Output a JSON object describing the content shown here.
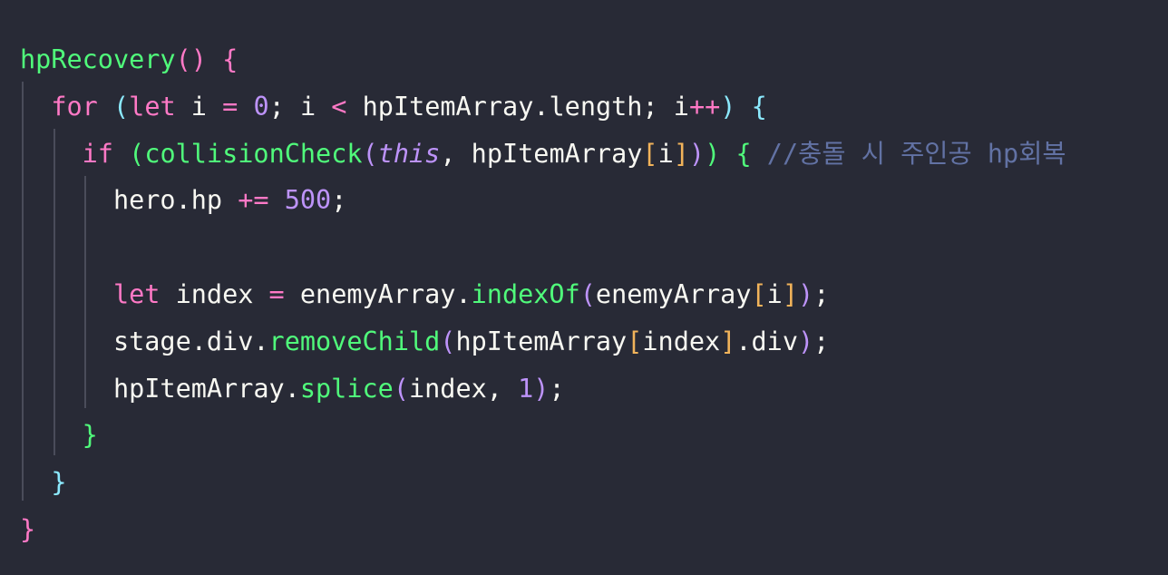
{
  "editor": {
    "theme_colors": {
      "background": "#282a36",
      "text": "#f8f8f2",
      "function": "#50fa7b",
      "keyword": "#ff79c6",
      "number": "#bd93f9",
      "comment": "#6272a4",
      "bracket_orange": "#f1b35a",
      "bracket_cyan": "#8be9fd"
    },
    "lines": [
      [
        {
          "t": "hpRecovery",
          "c": "fn"
        },
        {
          "t": "()",
          "c": "p1"
        },
        {
          "t": " ",
          "c": "txt"
        },
        {
          "t": "{",
          "c": "p1"
        }
      ],
      [
        {
          "t": "  ",
          "c": "txt"
        },
        {
          "t": "for",
          "c": "kw"
        },
        {
          "t": " ",
          "c": "txt"
        },
        {
          "t": "(",
          "c": "p2"
        },
        {
          "t": "let",
          "c": "kw"
        },
        {
          "t": " i ",
          "c": "txt"
        },
        {
          "t": "=",
          "c": "op"
        },
        {
          "t": " ",
          "c": "txt"
        },
        {
          "t": "0",
          "c": "num"
        },
        {
          "t": "; i ",
          "c": "txt"
        },
        {
          "t": "<",
          "c": "op"
        },
        {
          "t": " hpItemArray.length; i",
          "c": "txt"
        },
        {
          "t": "++",
          "c": "op"
        },
        {
          "t": ")",
          "c": "p2"
        },
        {
          "t": " ",
          "c": "txt"
        },
        {
          "t": "{",
          "c": "p2"
        }
      ],
      [
        {
          "t": "    ",
          "c": "txt"
        },
        {
          "t": "if",
          "c": "kw"
        },
        {
          "t": " ",
          "c": "txt"
        },
        {
          "t": "(",
          "c": "p3"
        },
        {
          "t": "collisionCheck",
          "c": "fn"
        },
        {
          "t": "(",
          "c": "p4"
        },
        {
          "t": "this",
          "c": "this"
        },
        {
          "t": ", hpItemArray",
          "c": "txt"
        },
        {
          "t": "[",
          "c": "br"
        },
        {
          "t": "i",
          "c": "txt"
        },
        {
          "t": "]",
          "c": "br"
        },
        {
          "t": ")",
          "c": "p4"
        },
        {
          "t": ")",
          "c": "p3"
        },
        {
          "t": " ",
          "c": "txt"
        },
        {
          "t": "{",
          "c": "p3"
        },
        {
          "t": " ",
          "c": "txt"
        },
        {
          "t": "//충돌 시 주인공 hp회복",
          "c": "cmt"
        }
      ],
      [
        {
          "t": "      hero.hp ",
          "c": "txt"
        },
        {
          "t": "+=",
          "c": "op"
        },
        {
          "t": " ",
          "c": "txt"
        },
        {
          "t": "500",
          "c": "num"
        },
        {
          "t": ";",
          "c": "txt"
        }
      ],
      [],
      [
        {
          "t": "      ",
          "c": "txt"
        },
        {
          "t": "let",
          "c": "kw"
        },
        {
          "t": " index ",
          "c": "txt"
        },
        {
          "t": "=",
          "c": "op"
        },
        {
          "t": " enemyArray.",
          "c": "txt"
        },
        {
          "t": "indexOf",
          "c": "fn"
        },
        {
          "t": "(",
          "c": "p4"
        },
        {
          "t": "enemyArray",
          "c": "txt"
        },
        {
          "t": "[",
          "c": "br"
        },
        {
          "t": "i",
          "c": "txt"
        },
        {
          "t": "]",
          "c": "br"
        },
        {
          "t": ")",
          "c": "p4"
        },
        {
          "t": ";",
          "c": "txt"
        }
      ],
      [
        {
          "t": "      stage.div.",
          "c": "txt"
        },
        {
          "t": "removeChild",
          "c": "fn"
        },
        {
          "t": "(",
          "c": "p4"
        },
        {
          "t": "hpItemArray",
          "c": "txt"
        },
        {
          "t": "[",
          "c": "br"
        },
        {
          "t": "index",
          "c": "txt"
        },
        {
          "t": "]",
          "c": "br"
        },
        {
          "t": ".div",
          "c": "txt"
        },
        {
          "t": ")",
          "c": "p4"
        },
        {
          "t": ";",
          "c": "txt"
        }
      ],
      [
        {
          "t": "      hpItemArray.",
          "c": "txt"
        },
        {
          "t": "splice",
          "c": "fn"
        },
        {
          "t": "(",
          "c": "p4"
        },
        {
          "t": "index, ",
          "c": "txt"
        },
        {
          "t": "1",
          "c": "num"
        },
        {
          "t": ")",
          "c": "p4"
        },
        {
          "t": ";",
          "c": "txt"
        }
      ],
      [
        {
          "t": "    ",
          "c": "txt"
        },
        {
          "t": "}",
          "c": "p3"
        }
      ],
      [
        {
          "t": "  ",
          "c": "txt"
        },
        {
          "t": "}",
          "c": "p2"
        }
      ],
      [
        {
          "t": "}",
          "c": "p1"
        }
      ]
    ]
  }
}
